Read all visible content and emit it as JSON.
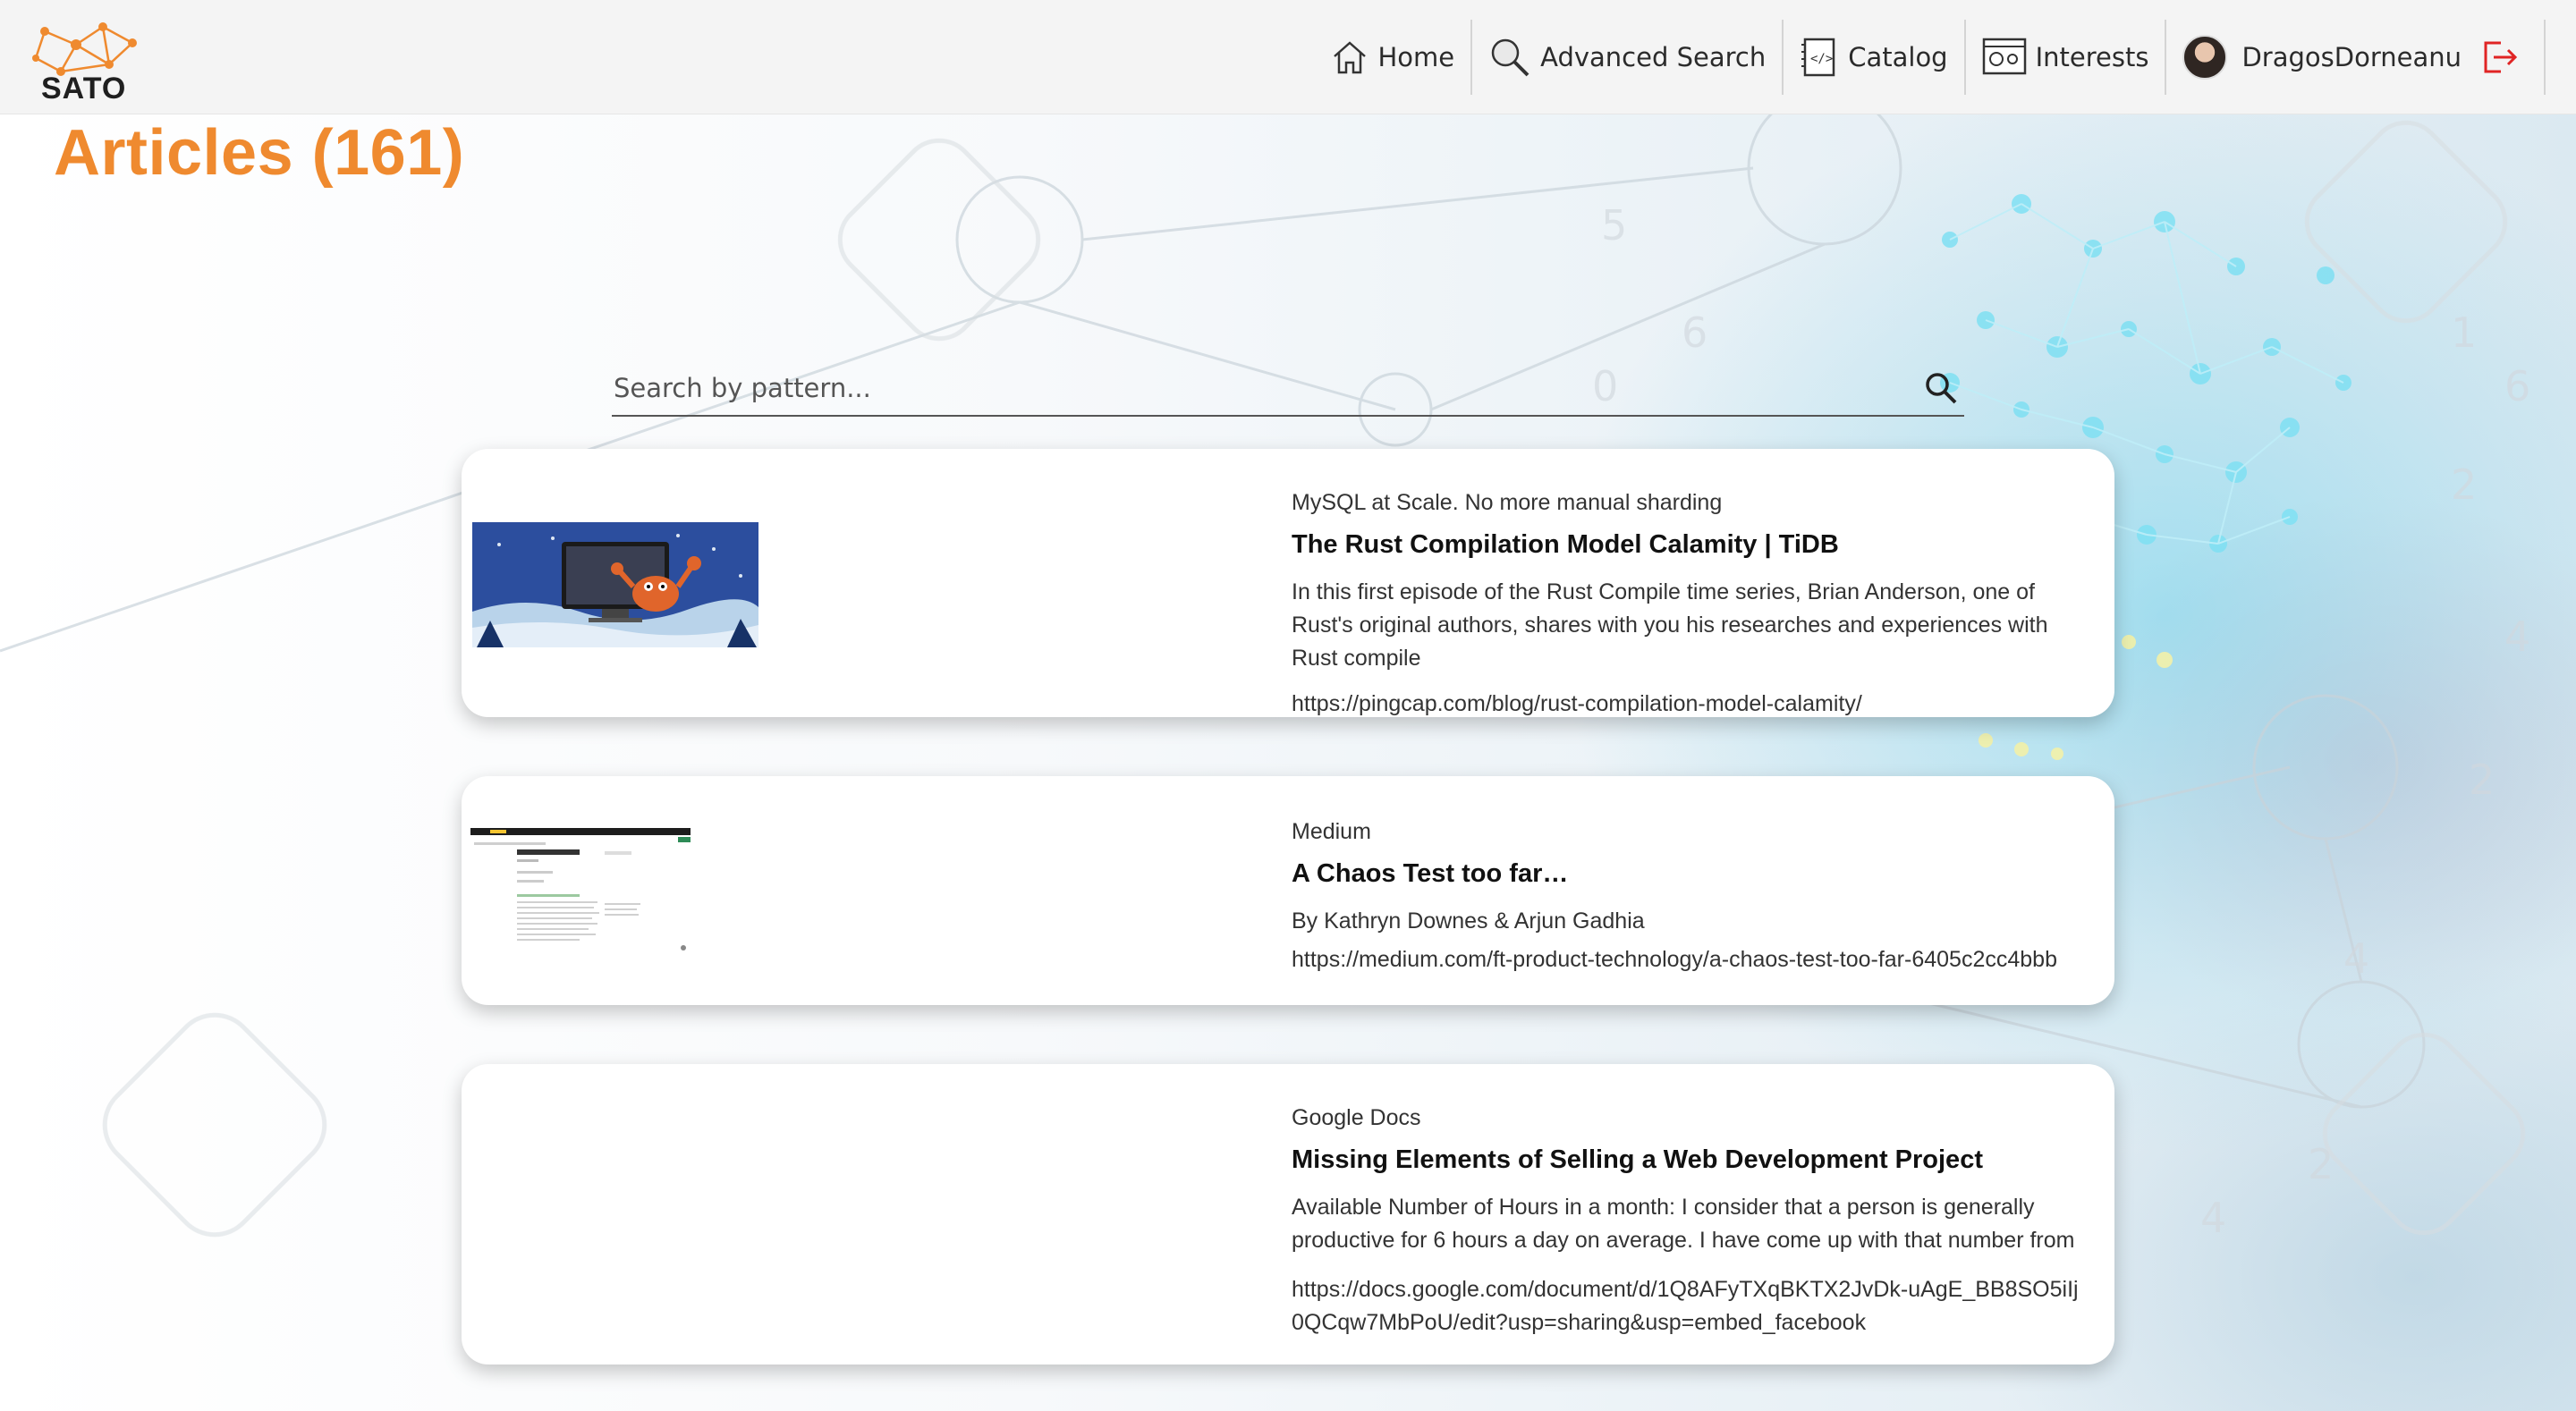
{
  "brand": {
    "name": "SATO",
    "accent": "#ef8a2f"
  },
  "nav": {
    "items": [
      {
        "label": "Home",
        "icon": "home-icon"
      },
      {
        "label": "Advanced Search",
        "icon": "magnifier-icon"
      },
      {
        "label": "Catalog",
        "icon": "catalog-icon"
      },
      {
        "label": "Interests",
        "icon": "interests-icon"
      }
    ],
    "user": {
      "name": "DragosDorneanu",
      "avatar": "avatar",
      "logout_icon": "logout-icon",
      "logout_color": "#e02424"
    }
  },
  "page": {
    "title": "Articles (161)"
  },
  "search": {
    "placeholder": "Search by pattern..."
  },
  "articles": [
    {
      "source": "MySQL at Scale. No more manual sharding",
      "title": "The Rust Compilation Model Calamity | TiDB",
      "description": "In this first episode of the Rust Compile time series, Brian Anderson, one of Rust's original authors, shares with you his researches and experiences with Rust compile",
      "url": "https://pingcap.com/blog/rust-compilation-model-calamity/",
      "thumbnail": "crab-at-computer-image"
    },
    {
      "source": "Medium",
      "title": "A Chaos Test too far…",
      "description": "By Kathryn Downes & Arjun Gadhia",
      "url": "https://medium.com/ft-product-technology/a-chaos-test-too-far-6405c2cc4bbb",
      "thumbnail": "webpage-screenshot-image"
    },
    {
      "source": "Google Docs",
      "title": "Missing Elements of Selling a Web Development Project",
      "description": "Available Number of Hours in a month: I consider that a person is generally productive for 6 hours a day on average. I have come up with that number from",
      "url": "https://docs.google.com/document/d/1Q8AFyTXqBKTX2JvDk-uAgE_BB8SO5iIj0QCqw7MbPoU/edit?usp=sharing&usp=embed_facebook",
      "thumbnail": ""
    }
  ]
}
